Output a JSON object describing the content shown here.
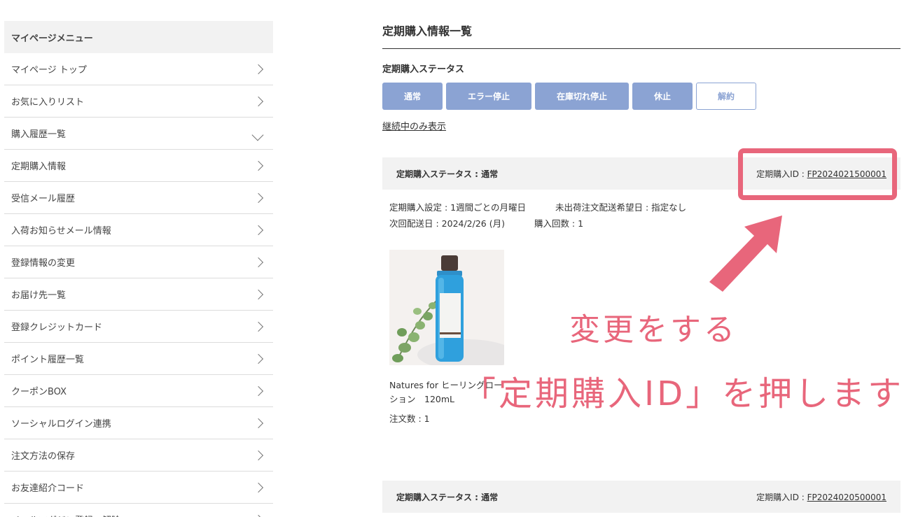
{
  "sidebar": {
    "title": "マイページメニュー",
    "items": [
      {
        "label": "マイページ トップ",
        "chevron": "right"
      },
      {
        "label": "お気に入りリスト",
        "chevron": "right"
      },
      {
        "label": "購入履歴一覧",
        "chevron": "down"
      },
      {
        "label": "定期購入情報",
        "chevron": "right"
      },
      {
        "label": "受信メール履歴",
        "chevron": "right"
      },
      {
        "label": "入荷お知らせメール情報",
        "chevron": "right"
      },
      {
        "label": "登録情報の変更",
        "chevron": "right"
      },
      {
        "label": "お届け先一覧",
        "chevron": "right"
      },
      {
        "label": "登録クレジットカード",
        "chevron": "right"
      },
      {
        "label": "ポイント履歴一覧",
        "chevron": "right"
      },
      {
        "label": "クーポンBOX",
        "chevron": "right"
      },
      {
        "label": "ソーシャルログイン連携",
        "chevron": "right"
      },
      {
        "label": "注文方法の保存",
        "chevron": "right"
      },
      {
        "label": "お友達紹介コード",
        "chevron": "right"
      },
      {
        "label": "メールマガジン登録・解除",
        "chevron": "right"
      }
    ]
  },
  "main": {
    "page_title": "定期購入情報一覧",
    "status_label": "定期購入ステータス",
    "filters": [
      {
        "label": "通常",
        "style": "filled"
      },
      {
        "label": "エラー停止",
        "style": "filled"
      },
      {
        "label": "在庫切れ停止",
        "style": "filled"
      },
      {
        "label": "休止",
        "style": "filled"
      },
      {
        "label": "解約",
        "style": "outline"
      }
    ],
    "only_active_link": "継続中のみ表示",
    "subscriptions": [
      {
        "status_text": "定期購入ステータス : 通常",
        "id_label": "定期購入ID : ",
        "id_value": "FP2024021500001",
        "setting": "定期購入設定 : 1週間ごとの月曜日",
        "unshipped": "未出荷注文配送希望日 : 指定なし",
        "next_ship": "次回配送日 : 2024/2/26 (月)",
        "purchase_count": "購入回数 : 1",
        "product_name": "Natures for ヒーリングローション　120mL",
        "order_count": "注文数 : 1"
      },
      {
        "status_text": "定期購入ステータス : 通常",
        "id_label": "定期購入ID : ",
        "id_value": "FP2024020500001"
      }
    ]
  },
  "annotation": {
    "line1": "変更をする",
    "line2": "「定期購入ID」を押します",
    "color": "#e8667b"
  },
  "colors": {
    "filter_button": "#8ba3d3",
    "panel_bg": "#f2f2f2"
  }
}
